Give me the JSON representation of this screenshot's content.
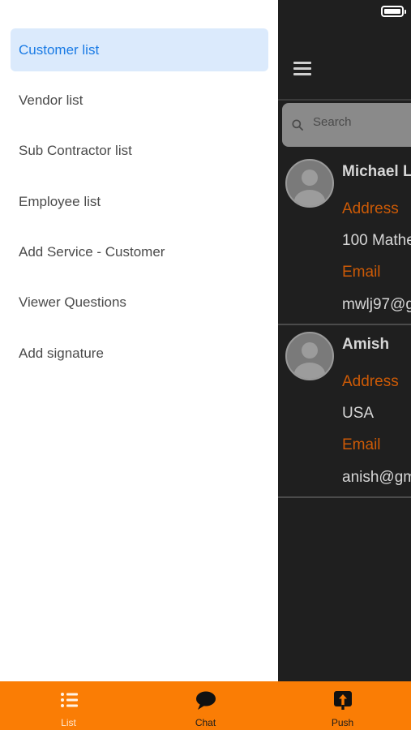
{
  "drawer": {
    "items": [
      {
        "label": "Customer list",
        "active": true
      },
      {
        "label": "Vendor list",
        "active": false
      },
      {
        "label": "Sub Contractor list",
        "active": false
      },
      {
        "label": "Employee list",
        "active": false
      },
      {
        "label": "Add Service - Customer",
        "active": false
      },
      {
        "label": "Viewer Questions",
        "active": false
      },
      {
        "label": "Add signature",
        "active": false
      }
    ]
  },
  "main": {
    "search": {
      "placeholder": "Search"
    },
    "contacts": [
      {
        "name": "Michael L",
        "address_label": "Address",
        "address": "100 Mathe",
        "email_label": "Email",
        "email": "mwlj97@g"
      },
      {
        "name": "Amish",
        "address_label": "Address",
        "address": "USA",
        "email_label": "Email",
        "email": "anish@gm"
      }
    ]
  },
  "tabbar": {
    "tabs": [
      {
        "label": "List",
        "icon": "list-icon"
      },
      {
        "label": "Chat",
        "icon": "chat-icon"
      },
      {
        "label": "Push",
        "icon": "push-icon"
      }
    ]
  },
  "colors": {
    "accent": "#1a7be5",
    "active_bg": "#dbeafc",
    "tabbar": "#fa7d05",
    "label_orange": "#cc5a06",
    "dark_bg": "#1f1f1f"
  }
}
